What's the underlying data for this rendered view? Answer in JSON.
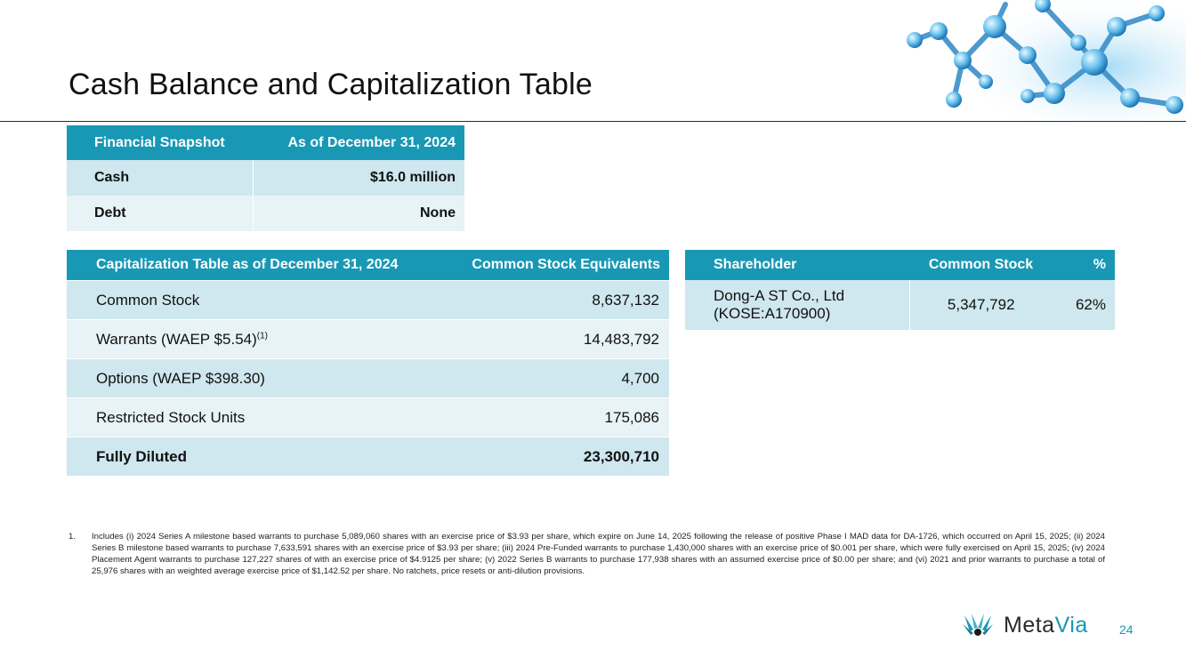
{
  "title": "Cash Balance and Capitalization Table",
  "snapshot": {
    "headers": [
      "Financial Snapshot",
      "As of December 31, 2024"
    ],
    "rows": [
      {
        "label": "Cash",
        "value": "$16.0 million"
      },
      {
        "label": "Debt",
        "value": "None"
      }
    ]
  },
  "cap_table": {
    "headers": [
      "Capitalization Table as of December 31, 2024",
      "Common Stock Equivalents"
    ],
    "rows": [
      {
        "label": "Common Stock",
        "value": "8,637,132"
      },
      {
        "label": "Warrants (WAEP $5.54)",
        "sup": "(1)",
        "value": "14,483,792"
      },
      {
        "label": "Options (WAEP $398.30)",
        "value": "4,700"
      },
      {
        "label": "Restricted Stock Units",
        "value": "175,086"
      },
      {
        "label": "Fully Diluted",
        "value": "23,300,710"
      }
    ]
  },
  "shareholders": {
    "headers": [
      "Shareholder",
      "Common Stock",
      "%"
    ],
    "rows": [
      {
        "name_line1": "Dong-A ST Co., Ltd",
        "name_line2": "(KOSE:A170900)",
        "common_stock": "5,347,792",
        "percent": "62%"
      }
    ]
  },
  "footnote": {
    "number": "1.",
    "text": "Includes (i) 2024 Series A milestone based warrants to purchase 5,089,060 shares with an exercise price of $3.93 per share, which expire on June 14, 2025 following the release of positive Phase I MAD data for DA-1726, which occurred on April 15, 2025; (ii) 2024 Series B milestone based warrants to purchase 7,633,591 shares with an exercise price of $3.93 per share; (iii) 2024 Pre-Funded warrants to purchase 1,430,000 shares with an exercise price of $0.001 per share, which were fully exercised on April 15, 2025; (iv) 2024 Placement Agent warrants to purchase 127,227 shares of with an exercise price of $4.9125 per share; (v) 2022 Series B warrants to purchase 177,938 shares with an assumed exercise price of $0.00 per share; and (vi) 2021 and prior warrants to purchase a total of 25,976 shares with an weighted average exercise price of $1,142.52 per share. No ratchets, price resets or anti-dilution provisions."
  },
  "logo": {
    "meta": "Meta",
    "via": "Via"
  },
  "page_number": "24",
  "colors": {
    "header": "#1898b4",
    "row_dark": "#cfe7ee",
    "row_light": "#e7f3f6",
    "brand": "#1898b4"
  },
  "icons": [
    "molecule-illustration",
    "metavia-logo-icon"
  ]
}
